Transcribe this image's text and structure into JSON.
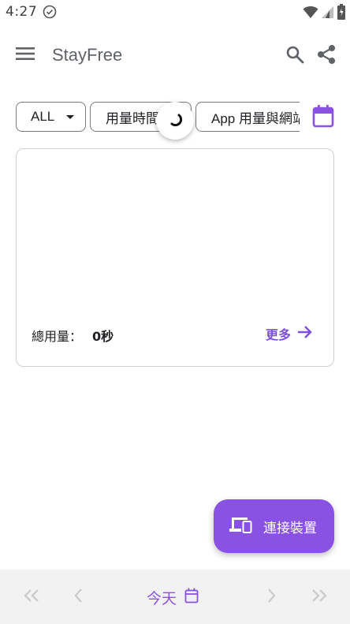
{
  "status_bar": {
    "time": "4:27",
    "icons": [
      "check-circle-icon",
      "wifi-icon",
      "signal-icon",
      "battery-icon"
    ]
  },
  "app_bar": {
    "title": "StayFree",
    "icons": [
      "menu-icon",
      "search-icon",
      "share-icon"
    ]
  },
  "filters": {
    "device": "ALL",
    "metric": "用量時間",
    "view": "App 用量與網站",
    "calendar_icon": "calendar-icon"
  },
  "summary": {
    "total_label": "總用量：",
    "total_value": "0秒",
    "more_label": "更多"
  },
  "fab": {
    "label": "連接裝置",
    "icon": "devices-icon"
  },
  "bottom_nav": {
    "today_label": "今天",
    "icons": [
      "first-page-icon",
      "prev-icon",
      "calendar-icon",
      "next-icon",
      "last-page-icon"
    ]
  },
  "colors": {
    "accent": "#8a52e3",
    "link": "#7b4fd8",
    "text": "#202124",
    "nav_bg": "#f2f2f2",
    "disabled": "#c9c9c9"
  }
}
